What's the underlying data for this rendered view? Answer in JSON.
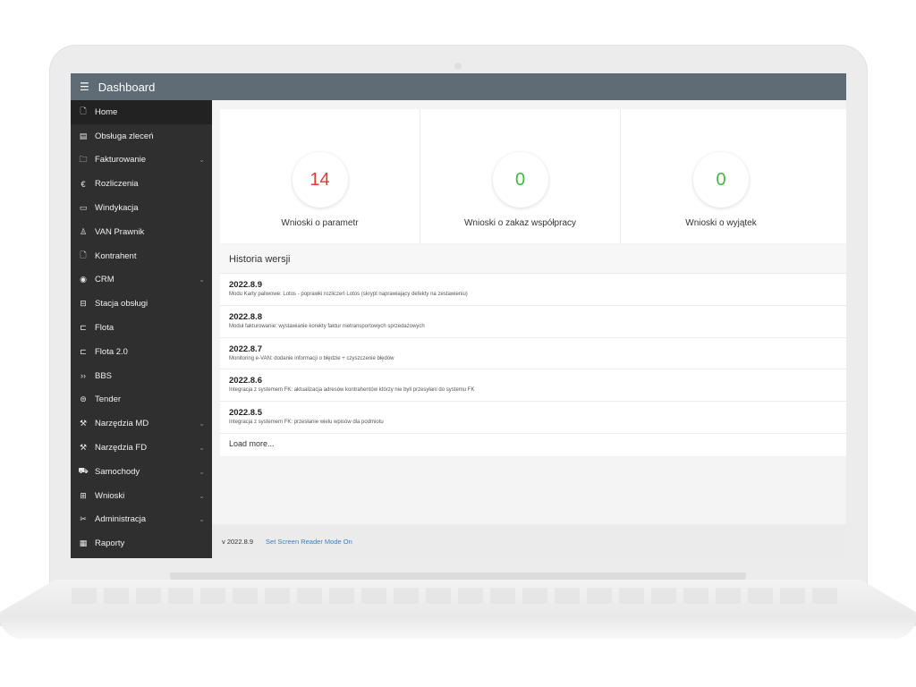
{
  "topbar": {
    "menu_icon": "hamburger-icon",
    "title": "Dashboard"
  },
  "sidebar": {
    "items": [
      {
        "label": "Home",
        "icon": "file-icon",
        "glyph": "🗋",
        "active": true,
        "expandable": false
      },
      {
        "label": "Obsługa zleceń",
        "icon": "list-icon",
        "glyph": "▤",
        "active": false,
        "expandable": false
      },
      {
        "label": "Fakturowanie",
        "icon": "folder-icon",
        "glyph": "🗀",
        "active": false,
        "expandable": true
      },
      {
        "label": "Rozliczenia",
        "icon": "euro-icon",
        "glyph": "€",
        "active": false,
        "expandable": false
      },
      {
        "label": "Windykacja",
        "icon": "card-icon",
        "glyph": "▭",
        "active": false,
        "expandable": false
      },
      {
        "label": "VAN Prawnik",
        "icon": "person-icon",
        "glyph": "♙",
        "active": false,
        "expandable": false
      },
      {
        "label": "Kontrahent",
        "icon": "file-icon",
        "glyph": "🗋",
        "active": false,
        "expandable": false
      },
      {
        "label": "CRM",
        "icon": "eye-icon",
        "glyph": "◉",
        "active": false,
        "expandable": true
      },
      {
        "label": "Stacja obsługi",
        "icon": "bus-icon",
        "glyph": "⊟",
        "active": false,
        "expandable": false
      },
      {
        "label": "Flota",
        "icon": "truck-icon",
        "glyph": "⊏",
        "active": false,
        "expandable": false
      },
      {
        "label": "Flota 2.0",
        "icon": "truck-icon",
        "glyph": "⊏",
        "active": false,
        "expandable": false
      },
      {
        "label": "BBS",
        "icon": "double-chevron-icon",
        "glyph": "››",
        "active": false,
        "expandable": false
      },
      {
        "label": "Tender",
        "icon": "box-icon",
        "glyph": "⊜",
        "active": false,
        "expandable": false
      },
      {
        "label": "Narzędzia MD",
        "icon": "wrench-icon",
        "glyph": "⚒",
        "active": false,
        "expandable": true
      },
      {
        "label": "Narzędzia FD",
        "icon": "wrench-icon",
        "glyph": "⚒",
        "active": false,
        "expandable": true
      },
      {
        "label": "Samochody",
        "icon": "car-icon",
        "glyph": "⛟",
        "active": false,
        "expandable": true
      },
      {
        "label": "Wnioski",
        "icon": "book-icon",
        "glyph": "⊞",
        "active": false,
        "expandable": true
      },
      {
        "label": "Administracja",
        "icon": "tools-icon",
        "glyph": "✂",
        "active": false,
        "expandable": true
      },
      {
        "label": "Raporty",
        "icon": "report-icon",
        "glyph": "▦",
        "active": false,
        "expandable": false
      }
    ]
  },
  "stats": [
    {
      "value": "14",
      "label": "Wnioski o parametr",
      "color": "#e53935"
    },
    {
      "value": "0",
      "label": "Wnioski o zakaz współpracy",
      "color": "#43b649"
    },
    {
      "value": "0",
      "label": "Wnioski o wyjątek",
      "color": "#43b649"
    }
  ],
  "history": {
    "title": "Historia wersji",
    "entries": [
      {
        "version": "2022.8.9",
        "description": "Modu Karty paliwowe: Lotos - poprawki rozliczeń Lotos (skrypt naprawiający defekty na zestawieniu)"
      },
      {
        "version": "2022.8.8",
        "description": "Moduł fakturowanie: wystawianie korekty faktur nietransportowych sprzedażowych"
      },
      {
        "version": "2022.8.7",
        "description": "Monitoring e-VAN: dodanie informacji o błędzie + czyszczenie błędów"
      },
      {
        "version": "2022.8.6",
        "description": "Integracja z systemem FK: aktualizacja adresów kontrahentów którzy nie byli przesyłani do systemu FK"
      },
      {
        "version": "2022.8.5",
        "description": "Integracja z systemem FK: przesłanie wielu wpisów dla podmiotu"
      }
    ],
    "load_more": "Load more..."
  },
  "footer": {
    "version": "v 2022.8.9",
    "link": "Set Screen Reader Mode On"
  }
}
